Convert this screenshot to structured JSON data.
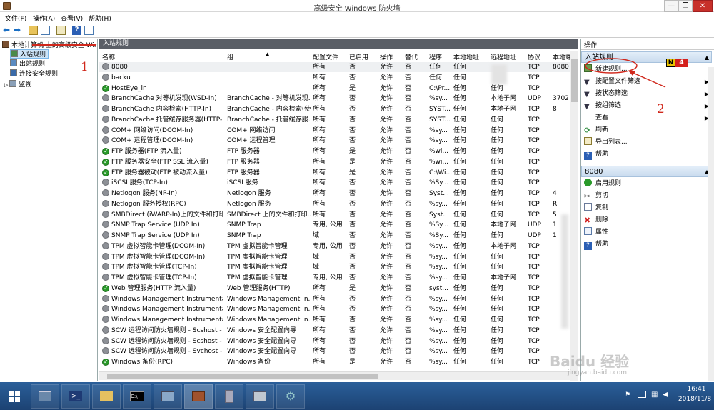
{
  "window": {
    "title": "高级安全 Windows 防火墙",
    "min": "—",
    "max": "❐",
    "close": "✕"
  },
  "menu": [
    "文件(F)",
    "操作(A)",
    "查看(V)",
    "帮助(H)"
  ],
  "tree": {
    "root": "本地计算机 上的高级安全 Win",
    "items": [
      "入站规则",
      "出站规则",
      "连接安全规则",
      "监视"
    ]
  },
  "center": {
    "header": "入站规则",
    "columns": [
      "名称",
      "组",
      "配置文件",
      "已启用",
      "操作",
      "替代",
      "程序",
      "本地地址",
      "远程地址",
      "协议",
      "本地端"
    ],
    "rows": [
      {
        "s": "off",
        "name": "8080",
        "group": "",
        "profile": "所有",
        "enabled": "否",
        "action": "允许",
        "override": "否",
        "program": "任何",
        "local": "任何",
        "remote": "",
        "proto": "TCP",
        "port": "8080"
      },
      {
        "s": "off",
        "name": "backu",
        "group": "",
        "profile": "所有",
        "enabled": "否",
        "action": "允许",
        "override": "否",
        "program": "任何",
        "local": "任何",
        "remote": "",
        "proto": "TCP",
        "port": ""
      },
      {
        "s": "on",
        "name": "HostEye_in",
        "group": "",
        "profile": "所有",
        "enabled": "是",
        "action": "允许",
        "override": "否",
        "program": "C:\\Pr...",
        "local": "任何",
        "remote": "任何",
        "proto": "TCP",
        "port": ""
      },
      {
        "s": "off",
        "name": "BranchCache 对等机发现(WSD-In)",
        "group": "BranchCache - 对等机发现...",
        "profile": "所有",
        "enabled": "否",
        "action": "允许",
        "override": "否",
        "program": "%sy...",
        "local": "任何",
        "remote": "本地子网",
        "proto": "UDP",
        "port": "3702"
      },
      {
        "s": "off",
        "name": "BranchCache 内容检索(HTTP-In)",
        "group": "BranchCache - 内容检索(使...",
        "profile": "所有",
        "enabled": "否",
        "action": "允许",
        "override": "否",
        "program": "SYST...",
        "local": "任何",
        "remote": "本地子网",
        "proto": "TCP",
        "port": "8"
      },
      {
        "s": "off",
        "name": "BranchCache 托管缓存服务器(HTTP-In)",
        "group": "BranchCache - 托管缓存服...",
        "profile": "所有",
        "enabled": "否",
        "action": "允许",
        "override": "否",
        "program": "SYST...",
        "local": "任何",
        "remote": "任何",
        "proto": "TCP",
        "port": ""
      },
      {
        "s": "off",
        "name": "COM+ 网络访问(DCOM-In)",
        "group": "COM+ 网络访问",
        "profile": "所有",
        "enabled": "否",
        "action": "允许",
        "override": "否",
        "program": "%sy...",
        "local": "任何",
        "remote": "任何",
        "proto": "TCP",
        "port": ""
      },
      {
        "s": "off",
        "name": "COM+ 远程管理(DCOM-In)",
        "group": "COM+ 远程管理",
        "profile": "所有",
        "enabled": "否",
        "action": "允许",
        "override": "否",
        "program": "%sy...",
        "local": "任何",
        "remote": "任何",
        "proto": "TCP",
        "port": ""
      },
      {
        "s": "on",
        "name": "FTP 服务器(FTP 流入量)",
        "group": "FTP 服务器",
        "profile": "所有",
        "enabled": "是",
        "action": "允许",
        "override": "否",
        "program": "%wi...",
        "local": "任何",
        "remote": "任何",
        "proto": "TCP",
        "port": ""
      },
      {
        "s": "on",
        "name": "FTP 服务器安全(FTP SSL 流入量)",
        "group": "FTP 服务器",
        "profile": "所有",
        "enabled": "是",
        "action": "允许",
        "override": "否",
        "program": "%wi...",
        "local": "任何",
        "remote": "任何",
        "proto": "TCP",
        "port": ""
      },
      {
        "s": "on",
        "name": "FTP 服务器被动(FTP 被动流入量)",
        "group": "FTP 服务器",
        "profile": "所有",
        "enabled": "是",
        "action": "允许",
        "override": "否",
        "program": "C:\\Wi...",
        "local": "任何",
        "remote": "任何",
        "proto": "TCP",
        "port": ""
      },
      {
        "s": "off",
        "name": "iSCSI 服务(TCP-In)",
        "group": "iSCSI 服务",
        "profile": "所有",
        "enabled": "否",
        "action": "允许",
        "override": "否",
        "program": "%Sy...",
        "local": "任何",
        "remote": "任何",
        "proto": "TCP",
        "port": ""
      },
      {
        "s": "off",
        "name": "Netlogon 服务(NP-In)",
        "group": "Netlogon 服务",
        "profile": "所有",
        "enabled": "否",
        "action": "允许",
        "override": "否",
        "program": "Syst...",
        "local": "任何",
        "remote": "任何",
        "proto": "TCP",
        "port": "4"
      },
      {
        "s": "off",
        "name": "Netlogon 服务授权(RPC)",
        "group": "Netlogon 服务",
        "profile": "所有",
        "enabled": "否",
        "action": "允许",
        "override": "否",
        "program": "%sy...",
        "local": "任何",
        "remote": "任何",
        "proto": "TCP",
        "port": "R"
      },
      {
        "s": "off",
        "name": "SMBDirect (iWARP-In)上的文件和打印...",
        "group": "SMBDirect 上的文件和打印...",
        "profile": "所有",
        "enabled": "否",
        "action": "允许",
        "override": "否",
        "program": "Syst...",
        "local": "任何",
        "remote": "任何",
        "proto": "TCP",
        "port": "5"
      },
      {
        "s": "off",
        "name": "SNMP Trap Service (UDP In)",
        "group": "SNMP Trap",
        "profile": "专用, 公用",
        "enabled": "否",
        "action": "允许",
        "override": "否",
        "program": "%Sy...",
        "local": "任何",
        "remote": "本地子网",
        "proto": "UDP",
        "port": "1"
      },
      {
        "s": "off",
        "name": "SNMP Trap Service (UDP In)",
        "group": "SNMP Trap",
        "profile": "域",
        "enabled": "否",
        "action": "允许",
        "override": "否",
        "program": "%Sy...",
        "local": "任何",
        "remote": "任何",
        "proto": "UDP",
        "port": "1"
      },
      {
        "s": "off",
        "name": "TPM 虚拟智能卡管理(DCOM-In)",
        "group": "TPM 虚拟智能卡管理",
        "profile": "专用, 公用",
        "enabled": "否",
        "action": "允许",
        "override": "否",
        "program": "%sy...",
        "local": "任何",
        "remote": "本地子网",
        "proto": "TCP",
        "port": ""
      },
      {
        "s": "off",
        "name": "TPM 虚拟智能卡管理(DCOM-In)",
        "group": "TPM 虚拟智能卡管理",
        "profile": "域",
        "enabled": "否",
        "action": "允许",
        "override": "否",
        "program": "%sy...",
        "local": "任何",
        "remote": "任何",
        "proto": "TCP",
        "port": ""
      },
      {
        "s": "off",
        "name": "TPM 虚拟智能卡管理(TCP-In)",
        "group": "TPM 虚拟智能卡管理",
        "profile": "域",
        "enabled": "否",
        "action": "允许",
        "override": "否",
        "program": "%sy...",
        "local": "任何",
        "remote": "任何",
        "proto": "TCP",
        "port": ""
      },
      {
        "s": "off",
        "name": "TPM 虚拟智能卡管理(TCP-In)",
        "group": "TPM 虚拟智能卡管理",
        "profile": "专用, 公用",
        "enabled": "否",
        "action": "允许",
        "override": "否",
        "program": "%sy...",
        "local": "任何",
        "remote": "本地子网",
        "proto": "TCP",
        "port": ""
      },
      {
        "s": "on",
        "name": "Web 管理服务(HTTP 流入量)",
        "group": "Web 管理服务(HTTP)",
        "profile": "所有",
        "enabled": "是",
        "action": "允许",
        "override": "否",
        "program": "syst...",
        "local": "任何",
        "remote": "任何",
        "proto": "TCP",
        "port": ""
      },
      {
        "s": "off",
        "name": "Windows Management Instrumentati...",
        "group": "Windows Management In...",
        "profile": "所有",
        "enabled": "否",
        "action": "允许",
        "override": "否",
        "program": "%sy...",
        "local": "任何",
        "remote": "任何",
        "proto": "TCP",
        "port": ""
      },
      {
        "s": "off",
        "name": "Windows Management Instrumentati...",
        "group": "Windows Management In...",
        "profile": "所有",
        "enabled": "否",
        "action": "允许",
        "override": "否",
        "program": "%sy...",
        "local": "任何",
        "remote": "任何",
        "proto": "TCP",
        "port": ""
      },
      {
        "s": "off",
        "name": "Windows Management Instrumentati...",
        "group": "Windows Management In...",
        "profile": "所有",
        "enabled": "否",
        "action": "允许",
        "override": "否",
        "program": "%sy...",
        "local": "任何",
        "remote": "任何",
        "proto": "TCP",
        "port": ""
      },
      {
        "s": "off",
        "name": "SCW 远程访问防火墙规则 - Scshost - ...",
        "group": "Windows 安全配置向导",
        "profile": "所有",
        "enabled": "否",
        "action": "允许",
        "override": "否",
        "program": "%sy...",
        "local": "任何",
        "remote": "任何",
        "proto": "TCP",
        "port": ""
      },
      {
        "s": "off",
        "name": "SCW 远程访问防火墙规则 - Scshost - ...",
        "group": "Windows 安全配置向导",
        "profile": "所有",
        "enabled": "否",
        "action": "允许",
        "override": "否",
        "program": "%sy...",
        "local": "任何",
        "remote": "任何",
        "proto": "TCP",
        "port": ""
      },
      {
        "s": "off",
        "name": "SCW 远程访问防火墙规则 - Svchost - T...",
        "group": "Windows 安全配置向导",
        "profile": "所有",
        "enabled": "否",
        "action": "允许",
        "override": "否",
        "program": "%sy...",
        "local": "任何",
        "remote": "任何",
        "proto": "TCP",
        "port": ""
      },
      {
        "s": "on",
        "name": "Windows 备份(RPC)",
        "group": "Windows 备份",
        "profile": "所有",
        "enabled": "是",
        "action": "允许",
        "override": "否",
        "program": "%sy...",
        "local": "任何",
        "remote": "任何",
        "proto": "TCP",
        "port": ""
      }
    ]
  },
  "actions": {
    "header": "操作",
    "section1": "入站规则",
    "items1": [
      "新建规则...",
      "按配置文件筛选",
      "按状态筛选",
      "按组筛选",
      "查看",
      "刷新",
      "导出列表...",
      "帮助"
    ],
    "section2": "8080",
    "items2": [
      "启用规则",
      "剪切",
      "复制",
      "删除",
      "属性",
      "帮助"
    ]
  },
  "annotations": {
    "n1": "1",
    "n2": "2",
    "badge": "N",
    "badge_num": "4"
  },
  "taskbar": {
    "time": "16:41",
    "date": "2018/11/8"
  },
  "watermark": {
    "brand": "Baidu 经验",
    "url": "jingyan.baidu.com"
  }
}
